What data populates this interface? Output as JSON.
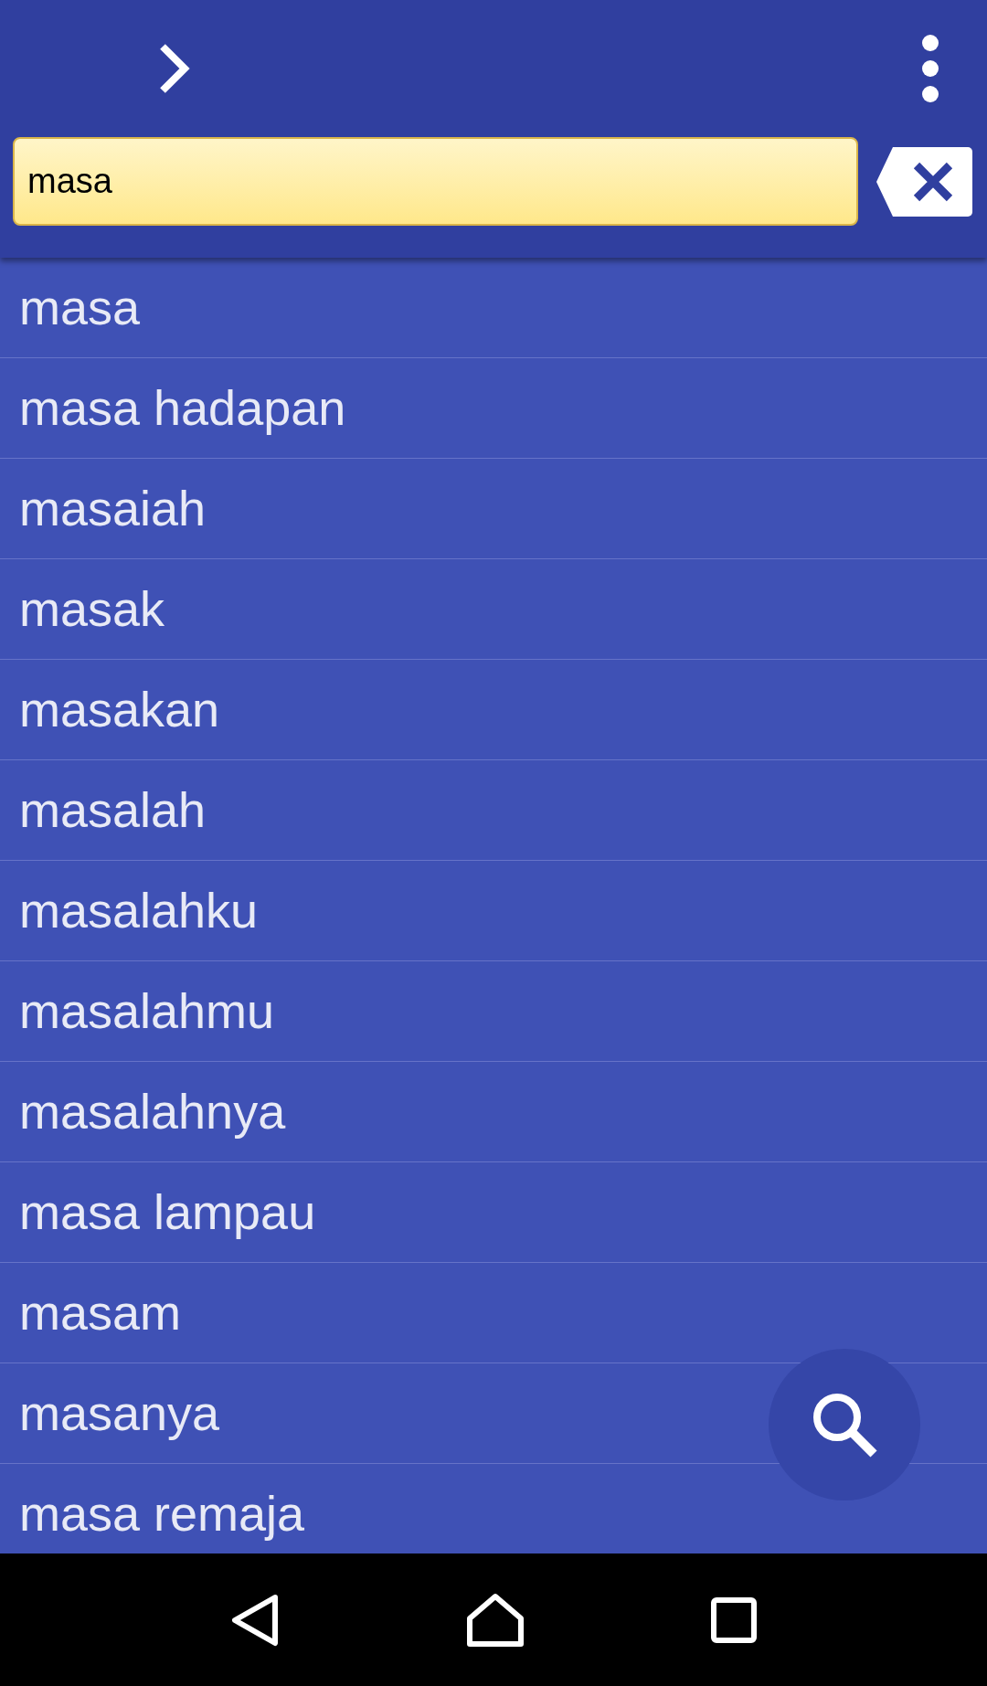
{
  "search": {
    "value": "masa"
  },
  "results": [
    "masa",
    "masa hadapan",
    "masaiah",
    "masak",
    "masakan",
    "masalah",
    "masalahku",
    "masalahmu",
    "masalahnya",
    "masa lampau",
    "masam",
    "masanya",
    "masa remaja"
  ]
}
